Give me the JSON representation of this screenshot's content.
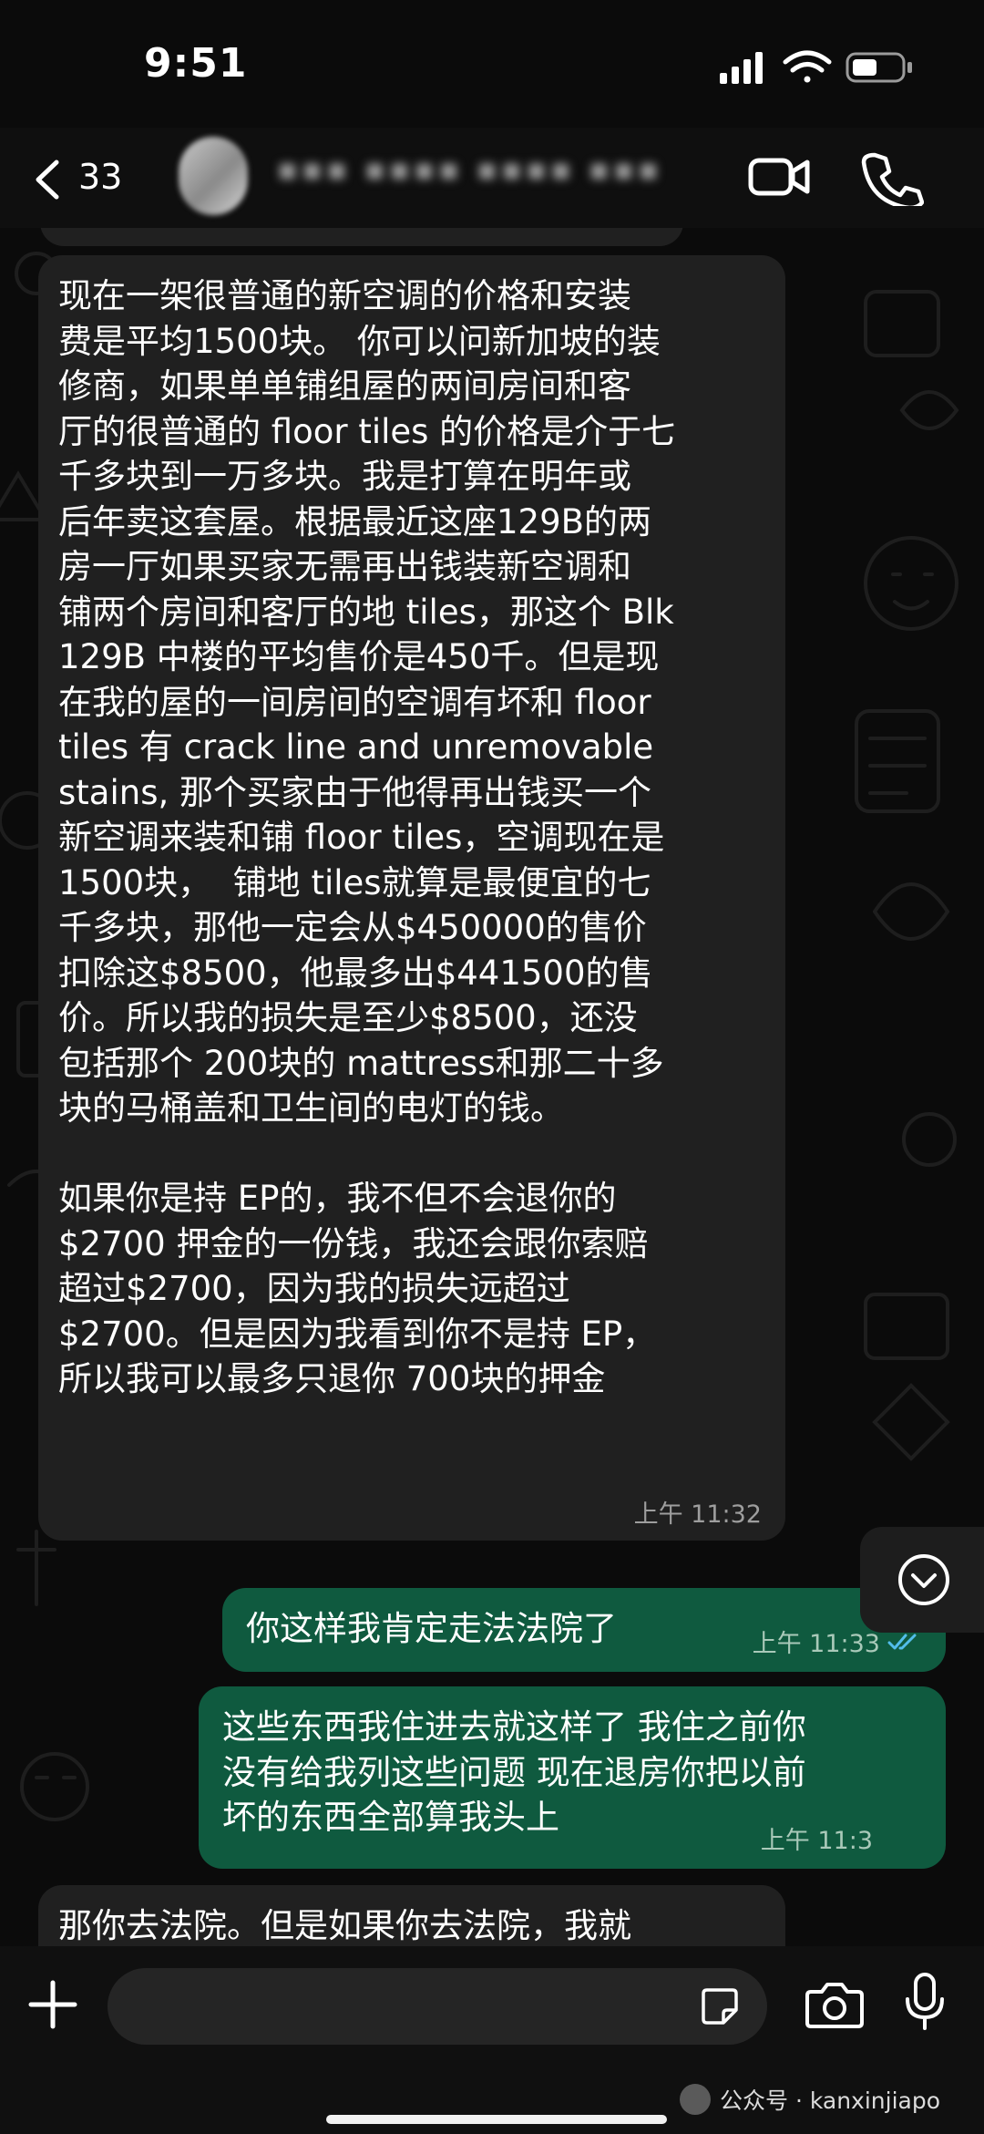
{
  "status_bar": {
    "time": "9:51"
  },
  "header": {
    "back_count": "33",
    "contact_name": "▪▪▪ ▪▪▪▪ ▪▪▪▪ ▪▪▪"
  },
  "messages": [
    {
      "direction": "in",
      "time": "上午 11:32",
      "text": "现在一架很普通的新空调的价格和安装\n费是平均1500块。 你可以问新加坡的装\n修商，如果单单铺组屋的两间房间和客\n厅的很普通的 floor tiles 的价格是介于七\n千多块到一万多块。我是打算在明年或\n后年卖这套屋。根据最近这座129B的两\n房一厅如果买家无需再出钱装新空调和\n铺两个房间和客厅的地 tiles，那这个 Blk\n129B 中楼的平均售价是450千。但是现\n在我的屋的一间房间的空调有坏和 floor\ntiles 有 crack line and unremovable\nstains, 那个买家由于他得再出钱买一个\n新空调来装和铺 floor tiles，空调现在是\n1500块，  铺地 tiles就算是最便宜的七\n千多块，那他一定会从$450000的售价\n扣除这$8500，他最多出$441500的售\n价。所以我的损失是至少$8500，还没\n包括那个 200块的 mattress和那二十多\n块的马桶盖和卫生间的电灯的钱。\n\n如果你是持 EP的，我不但不会退你的\n$2700 押金的一份钱，我还会跟你索赔\n超过$2700，因为我的损失远超过\n$2700。但是因为我看到你不是持 EP，\n所以我可以最多只退你 700块的押金"
    },
    {
      "direction": "out",
      "time": "上午 11:33",
      "text": "你这样我肯定走法法院了"
    },
    {
      "direction": "out",
      "time": "上午 11:3",
      "text": "这些东西我住进去就这样了 我住之前你\n没有给我列这些问题 现在退房你把以前\n坏的东西全部算我头上"
    },
    {
      "direction": "in",
      "time": "",
      "text": "那你去法院。但是如果你去法院，我就"
    }
  ],
  "watermark": {
    "text": "公众号 · kanxinjiapo"
  },
  "colors": {
    "incoming_bubble": "#202020",
    "outgoing_bubble": "#0f5a3f",
    "read_ticks": "#53bdeb"
  },
  "icons": [
    "back-chevron-icon",
    "video-call-icon",
    "phone-icon",
    "scroll-down-icon",
    "plus-icon",
    "sticker-icon",
    "camera-icon",
    "microphone-icon"
  ]
}
